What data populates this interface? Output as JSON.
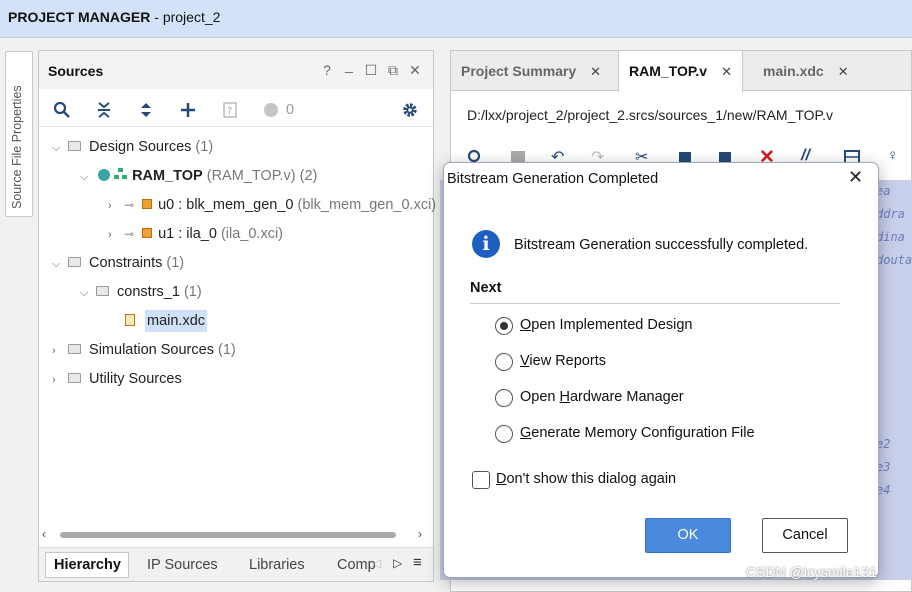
{
  "titlebar": {
    "app": "PROJECT MANAGER",
    "sep": " - ",
    "project": "project_2"
  },
  "side_tab": {
    "label": "Source File Properties"
  },
  "sources": {
    "title": "Sources",
    "header_buttons": {
      "help": "?",
      "minimize": "_",
      "maximize": "☐",
      "float": "⧉",
      "close": "✕"
    },
    "toolbar": {
      "count": "0"
    },
    "tree": [
      {
        "label": "Design Sources",
        "extra": "(1)"
      },
      {
        "label": "RAM_TOP",
        "extra": "(RAM_TOP.v) (2)"
      },
      {
        "label": "u0 : blk_mem_gen_0",
        "extra": "(blk_mem_gen_0.xci)"
      },
      {
        "label": "u1 : ila_0",
        "extra": "(ila_0.xci)"
      },
      {
        "label": "Constraints",
        "extra": "(1)"
      },
      {
        "label": "constrs_1",
        "extra": "(1)"
      },
      {
        "label": "main.xdc",
        "extra": ""
      },
      {
        "label": "Simulation Sources",
        "extra": "(1)"
      },
      {
        "label": "Utility Sources",
        "extra": ""
      }
    ],
    "bottom_tabs": [
      "Hierarchy",
      "IP Sources",
      "Libraries",
      "Comp"
    ]
  },
  "editor": {
    "tabs": [
      {
        "label": "Project Summary",
        "close": "✕"
      },
      {
        "label": "RAM_TOP.v",
        "close": "✕"
      },
      {
        "label": "main.xdc",
        "close": "✕"
      }
    ],
    "path": "D:/lxx/project_2/project_2.srcs/sources_1/new/RAM_TOP.v",
    "code_fragments": [
      "ea",
      "ddra",
      "dina",
      "douta",
      "e2",
      "e3",
      "e4"
    ]
  },
  "dialog": {
    "title": "Bitstream Generation Completed",
    "message": "Bitstream Generation successfully completed.",
    "next_label": "Next",
    "options": [
      {
        "pre": "",
        "u": "O",
        "post": "pen Implemented Design",
        "checked": true
      },
      {
        "pre": "",
        "u": "V",
        "post": "iew Reports",
        "checked": false
      },
      {
        "pre": "Open ",
        "u": "H",
        "post": "ardware Manager",
        "checked": false
      },
      {
        "pre": "",
        "u": "G",
        "post": "enerate Memory Configuration File",
        "checked": false
      }
    ],
    "dont_show": {
      "u": "D",
      "post": "on't show this dialog again",
      "checked": false
    },
    "ok_label": "OK",
    "cancel_label": "Cancel"
  },
  "watermark": "CSDN @icysmile131",
  "colors": {
    "accent": "#4a89dc",
    "titlebar": "#d4e2f7",
    "info": "#1d5fbf"
  }
}
